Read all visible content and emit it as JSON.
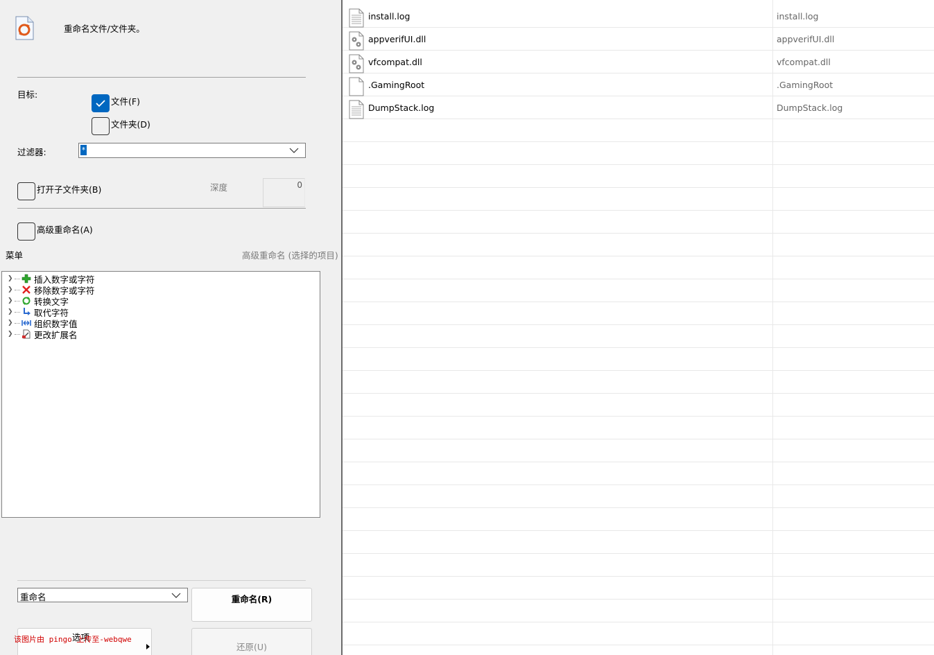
{
  "header": {
    "title": "重命名文件/文件夹。"
  },
  "target": {
    "label": "目标:",
    "files_label": "文件(F)",
    "files_checked": true,
    "folders_label": "文件夹(D)",
    "folders_checked": false
  },
  "filter": {
    "label": "过滤器:",
    "value": "*"
  },
  "subfolders": {
    "label": "打开子文件夹(B)",
    "checked": false,
    "depth_label": "深度",
    "depth_value": "0"
  },
  "advanced": {
    "label": "高级重命名(A)",
    "checked": false
  },
  "menu": {
    "label": "菜单",
    "right_label": "高级重命名 (选择的项目)",
    "items": [
      {
        "label": "插入数字或字符",
        "icon": "plus-icon"
      },
      {
        "label": "移除数字或字符",
        "icon": "x-icon"
      },
      {
        "label": "转换文字",
        "icon": "refresh-icon"
      },
      {
        "label": "取代字符",
        "icon": "replace-arrow-icon"
      },
      {
        "label": "组织数字值",
        "icon": "number-organize-icon"
      },
      {
        "label": "更改扩展名",
        "icon": "extension-icon"
      }
    ]
  },
  "action": {
    "mode_value": "重命名",
    "rename_button": "重命名(R)",
    "restore_button": "还原(U)",
    "options_button": "选项"
  },
  "watermark": "该图片由 pingo 上传至-webqwe",
  "files": {
    "rows": [
      {
        "original": "install.log",
        "new": "install.log",
        "icon": "text-file-icon"
      },
      {
        "original": "appverifUI.dll",
        "new": "appverifUI.dll",
        "icon": "dll-gear-icon"
      },
      {
        "original": "vfcompat.dll",
        "new": "vfcompat.dll",
        "icon": "dll-gear-icon"
      },
      {
        "original": ".GamingRoot",
        "new": ".GamingRoot",
        "icon": "blank-file-icon"
      },
      {
        "original": "DumpStack.log",
        "new": "DumpStack.log",
        "icon": "text-file-icon"
      }
    ]
  },
  "colors": {
    "accent": "#0067c0",
    "watermark": "#d10000"
  }
}
